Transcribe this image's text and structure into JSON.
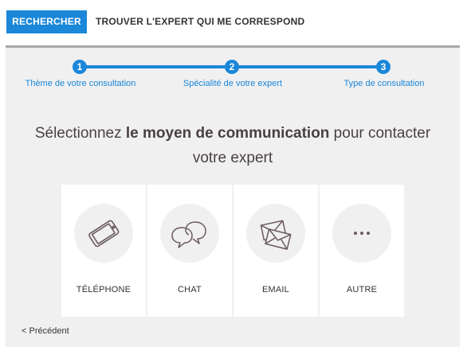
{
  "header": {
    "search_button": "RECHERCHER",
    "find_expert_label": "TROUVER L'EXPERT QUI ME CORRESPOND"
  },
  "stepper": {
    "steps": [
      {
        "number": "1",
        "label": "Thème de votre consultation"
      },
      {
        "number": "2",
        "label": "Spécialité de votre expert"
      },
      {
        "number": "3",
        "label": "Type de consultation"
      }
    ]
  },
  "headline": {
    "prefix": "Sélectionnez ",
    "bold": "le moyen de communication",
    "suffix": " pour contacter",
    "line2": "votre expert"
  },
  "options": [
    {
      "label": "TÉLÉPHONE",
      "icon": "smartphone-icon"
    },
    {
      "label": "CHAT",
      "icon": "chat-bubbles-icon"
    },
    {
      "label": "EMAIL",
      "icon": "envelope-icon"
    },
    {
      "label": "AUTRE",
      "icon": "more-dots-icon"
    }
  ],
  "footer": {
    "previous_link": "< Précédent"
  },
  "colors": {
    "accent": "#1a87d9",
    "panel_bg": "#f0f0f1",
    "icon_stroke": "#6a5a60"
  }
}
